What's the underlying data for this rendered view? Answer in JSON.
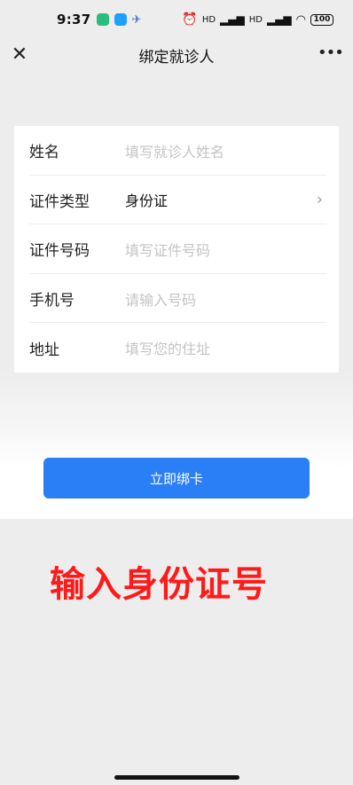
{
  "status_bar": {
    "time": "9:37",
    "battery": "100",
    "network_label": "HD"
  },
  "nav": {
    "close_icon": "close-icon",
    "title": "绑定就诊人",
    "more_icon": "more-icon"
  },
  "form": {
    "rows": [
      {
        "label": "姓名",
        "placeholder": "填写就诊人姓名",
        "value": ""
      },
      {
        "label": "证件类型",
        "placeholder": "",
        "value": "身份证"
      },
      {
        "label": "证件号码",
        "placeholder": "填写证件号码",
        "value": ""
      },
      {
        "label": "手机号",
        "placeholder": "请输入号码",
        "value": ""
      },
      {
        "label": "地址",
        "placeholder": "填写您的住址",
        "value": ""
      }
    ]
  },
  "submit_button": {
    "label": "立即绑卡"
  },
  "annotation": {
    "text": "输入身份证号"
  },
  "colors": {
    "accent": "#2b7ff6",
    "annotation": "#ff1a1a",
    "background": "#ededed"
  }
}
